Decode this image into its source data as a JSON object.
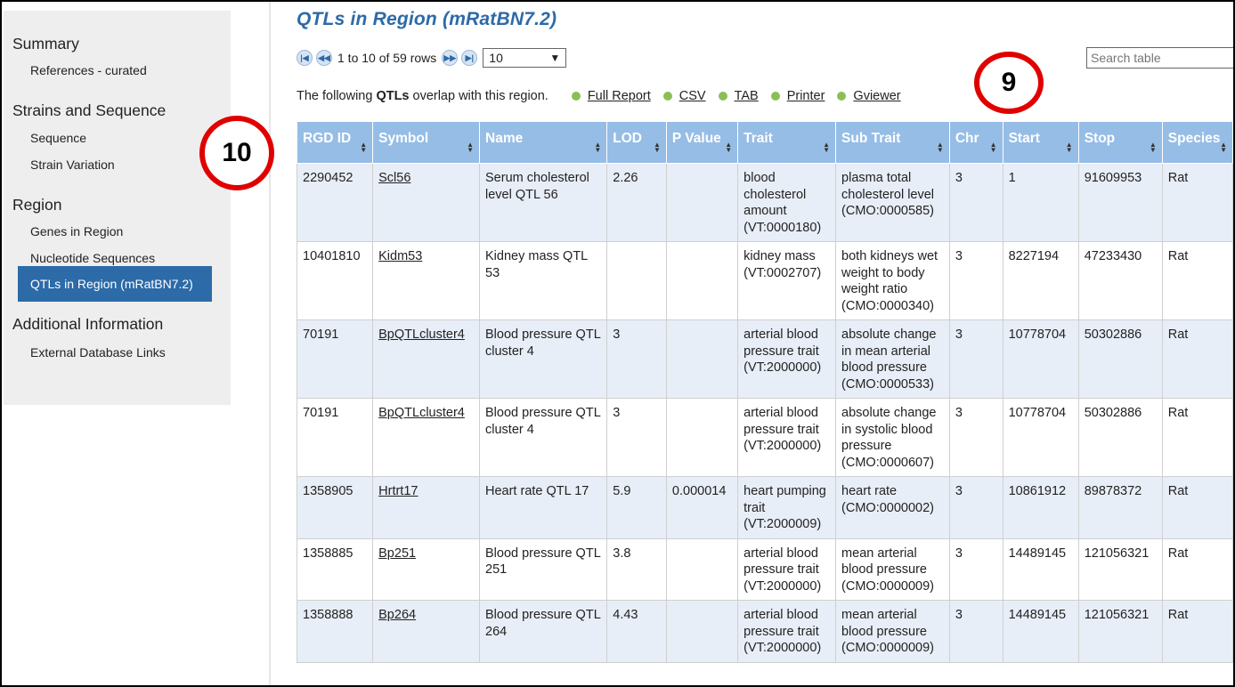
{
  "sidebar": {
    "sections": [
      {
        "title": "Summary",
        "items": [
          "References - curated"
        ]
      },
      {
        "title": "Strains and Sequence",
        "items": [
          "Sequence",
          "Strain Variation"
        ]
      },
      {
        "title": "Region",
        "items": [
          "Genes in Region",
          "Nucleotide Sequences",
          "QTLs in Region (mRatBN7.2)"
        ]
      },
      {
        "title": "Additional Information",
        "items": [
          "External Database Links"
        ]
      }
    ],
    "active_item": "QTLs in Region (mRatBN7.2)"
  },
  "main": {
    "title": "QTLs in Region (mRatBN7.2)",
    "pager": {
      "rows_info": "1 to 10 of 59 rows",
      "page_size": "10"
    },
    "search_placeholder": "Search table",
    "overlap_text_pre": "The following",
    "overlap_text_bold": "QTLs",
    "overlap_text_post": "overlap with this region.",
    "exports": [
      "Full Report",
      "CSV",
      "TAB",
      "Printer",
      "Gviewer"
    ]
  },
  "annotations": {
    "circle_9": "9",
    "circle_10": "10"
  },
  "table": {
    "columns": [
      "RGD ID",
      "Symbol",
      "Name",
      "LOD",
      "P Value",
      "Trait",
      "Sub Trait",
      "Chr",
      "Start",
      "Stop",
      "Species"
    ],
    "rows": [
      {
        "rgd_id": "2290452",
        "symbol": "Scl56",
        "name": "Serum cholesterol level QTL 56",
        "lod": "2.26",
        "p_value": "",
        "trait": "blood cholesterol amount (VT:0000180)",
        "sub_trait": "plasma total cholesterol level (CMO:0000585)",
        "chr": "3",
        "start": "1",
        "stop": "91609953",
        "species": "Rat"
      },
      {
        "rgd_id": "10401810",
        "symbol": "Kidm53",
        "name": "Kidney mass QTL 53",
        "lod": "",
        "p_value": "",
        "trait": "kidney mass (VT:0002707)",
        "sub_trait": "both kidneys wet weight to body weight ratio (CMO:0000340)",
        "chr": "3",
        "start": "8227194",
        "stop": "47233430",
        "species": "Rat"
      },
      {
        "rgd_id": "70191",
        "symbol": "BpQTLcluster4",
        "name": "Blood pressure QTL cluster 4",
        "lod": "3",
        "p_value": "",
        "trait": "arterial blood pressure trait (VT:2000000)",
        "sub_trait": "absolute change in mean arterial blood pressure (CMO:0000533)",
        "chr": "3",
        "start": "10778704",
        "stop": "50302886",
        "species": "Rat"
      },
      {
        "rgd_id": "70191",
        "symbol": "BpQTLcluster4",
        "name": "Blood pressure QTL cluster 4",
        "lod": "3",
        "p_value": "",
        "trait": "arterial blood pressure trait (VT:2000000)",
        "sub_trait": "absolute change in systolic blood pressure (CMO:0000607)",
        "chr": "3",
        "start": "10778704",
        "stop": "50302886",
        "species": "Rat"
      },
      {
        "rgd_id": "1358905",
        "symbol": "Hrtrt17",
        "name": "Heart rate QTL 17",
        "lod": "5.9",
        "p_value": "0.000014",
        "trait": "heart pumping trait (VT:2000009)",
        "sub_trait": "heart rate (CMO:0000002)",
        "chr": "3",
        "start": "10861912",
        "stop": "89878372",
        "species": "Rat"
      },
      {
        "rgd_id": "1358885",
        "symbol": "Bp251",
        "name": "Blood pressure QTL 251",
        "lod": "3.8",
        "p_value": "",
        "trait": "arterial blood pressure trait (VT:2000000)",
        "sub_trait": "mean arterial blood pressure (CMO:0000009)",
        "chr": "3",
        "start": "14489145",
        "stop": "121056321",
        "species": "Rat"
      },
      {
        "rgd_id": "1358888",
        "symbol": "Bp264",
        "name": "Blood pressure QTL 264",
        "lod": "4.43",
        "p_value": "",
        "trait": "arterial blood pressure trait (VT:2000000)",
        "sub_trait": "mean arterial blood pressure (CMO:0000009)",
        "chr": "3",
        "start": "14489145",
        "stop": "121056321",
        "species": "Rat"
      }
    ]
  }
}
